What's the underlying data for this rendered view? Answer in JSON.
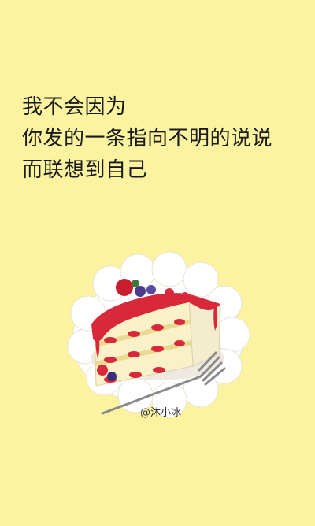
{
  "quote": {
    "lines": [
      "我不会因为",
      "你发的一条指向不明的说说",
      "而联想到自己"
    ]
  },
  "watermark": "@沐小冰",
  "colors": {
    "background": "#fbf3a0",
    "text": "#1a1a1a",
    "cake_red": "#d8283a"
  }
}
